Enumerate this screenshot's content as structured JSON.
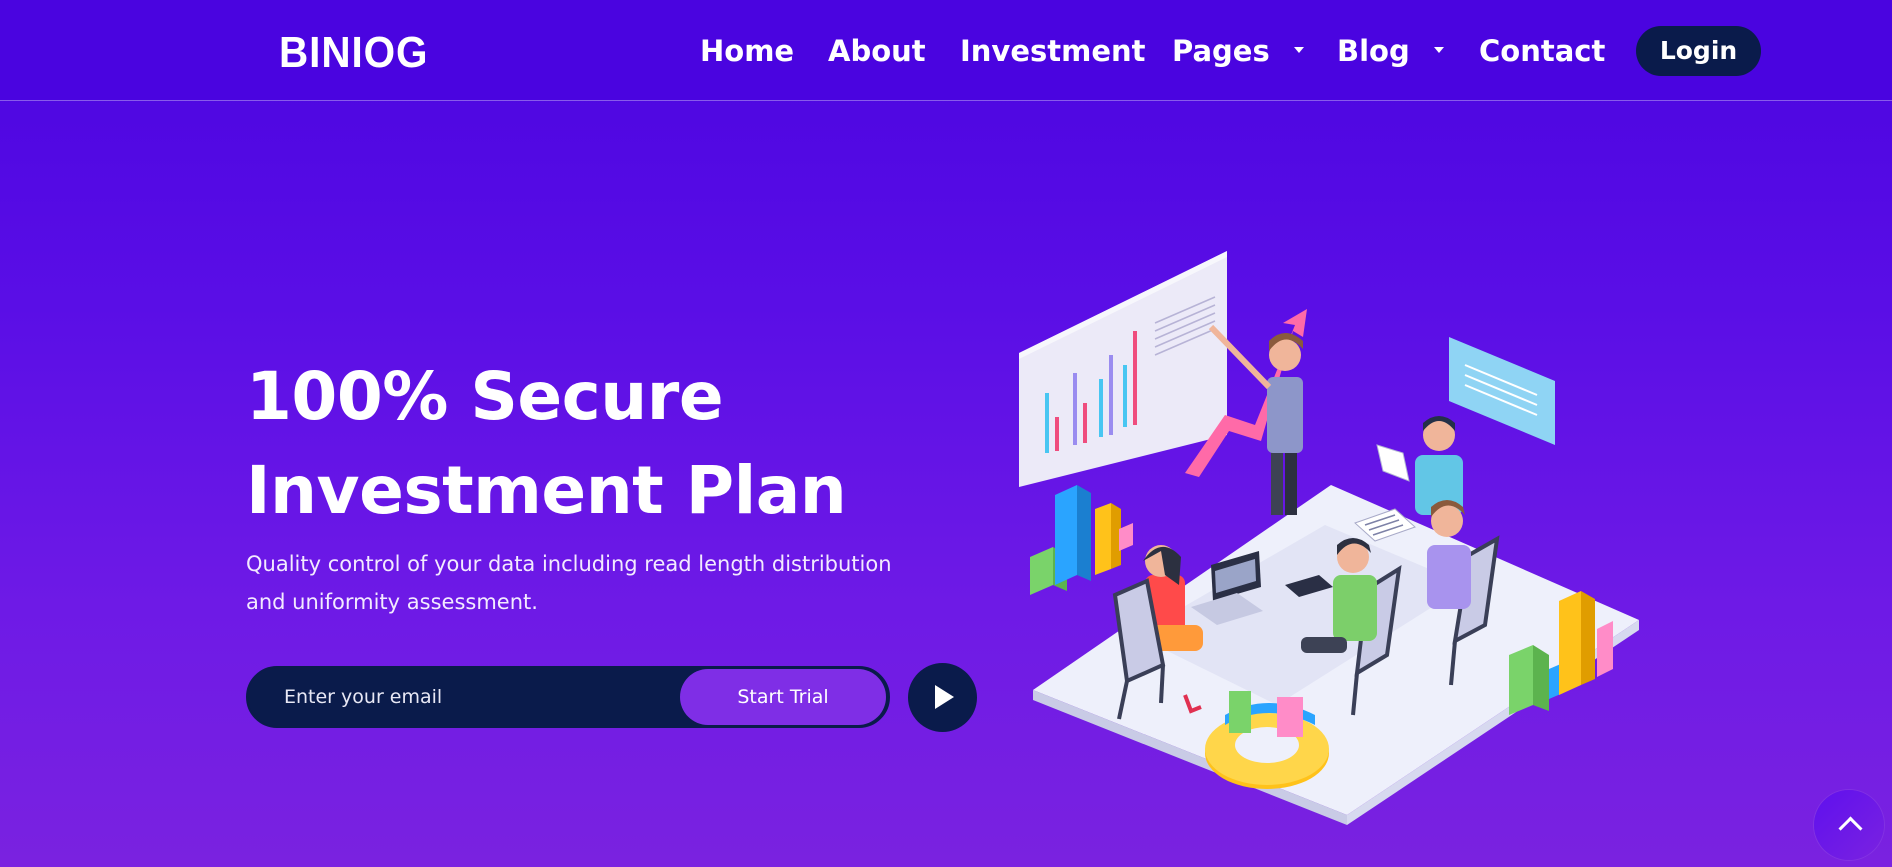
{
  "brand": {
    "logo_text": "BINIOG"
  },
  "nav": {
    "items": [
      {
        "label": "Home",
        "has_dropdown": false
      },
      {
        "label": "About",
        "has_dropdown": false
      },
      {
        "label": "Investment",
        "has_dropdown": false
      },
      {
        "label": "Pages",
        "has_dropdown": true
      },
      {
        "label": "Blog",
        "has_dropdown": true
      },
      {
        "label": "Contact",
        "has_dropdown": false
      }
    ],
    "login_label": "Login"
  },
  "hero": {
    "title_line1": "100% Secure",
    "title_line2": "Investment Plan",
    "subtitle": "Quality control of your data including read length distribution and uniformity assessment.",
    "email_placeholder": "Enter your email",
    "cta_label": "Start Trial"
  },
  "colors": {
    "header_bg": "#4a04e0",
    "hero_gradient_top": "#4a04e0",
    "hero_gradient_bottom": "#7a22e0",
    "dark_navy": "#0a1b4b",
    "cta_purple": "#7f2ee6"
  },
  "icons": {
    "play": "play-icon",
    "scroll_top": "chevron-up-icon",
    "dropdown": "caret-down-icon"
  }
}
